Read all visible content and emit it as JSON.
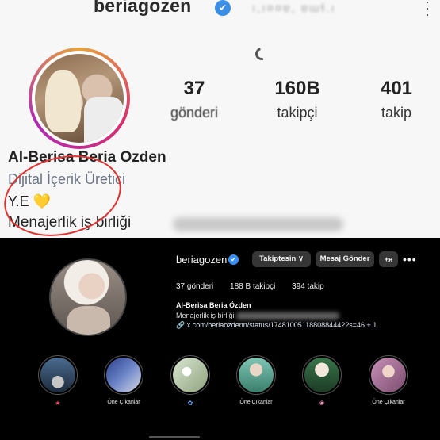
{
  "top_panel": {
    "username": "beriagozen",
    "verified_icon": "✔",
    "header_blurred": "ı,ı¤¤ɐ, ɐɯɬ.ı",
    "more_icon": "more-vertical-icon",
    "stats": [
      {
        "value": "37",
        "label": "gönderi"
      },
      {
        "value": "160B",
        "label": "takipçi"
      },
      {
        "value": "401",
        "label": "takip"
      }
    ],
    "full_name": "Al-Berisa  Beria Ozden",
    "category": "Dijital İçerik Üretici",
    "initials": "Y.E",
    "heart": "💛",
    "collab_text": "Menajerlik iş birliği",
    "annotation_color": "#e0312e"
  },
  "bottom_panel": {
    "username": "beriagozen",
    "follow_button": "Takiptesin ∨",
    "message_button": "Mesaj Gönder",
    "suggest_button": "+ᴙ",
    "more": "•••",
    "counts": {
      "posts": "37 gönderi",
      "followers": "188 B takipçi",
      "following": "394 takip"
    },
    "name": "Al-Berisa Beria Özden",
    "collab": "Menajerlik iş birliği",
    "link": "x.com/beriaozdenn/status/1748100511880884442?s=46 + 1",
    "highlights": [
      {
        "label": "★",
        "label_color": "red"
      },
      {
        "label": "Öne Çıkanlar",
        "label_color": "white"
      },
      {
        "label": "✿",
        "label_color": "blue"
      },
      {
        "label": "Öne Çıkanlar",
        "label_color": "white"
      },
      {
        "label": "❀",
        "label_color": "pink"
      },
      {
        "label": "Öne Çıkanlar",
        "label_color": "white"
      }
    ]
  }
}
